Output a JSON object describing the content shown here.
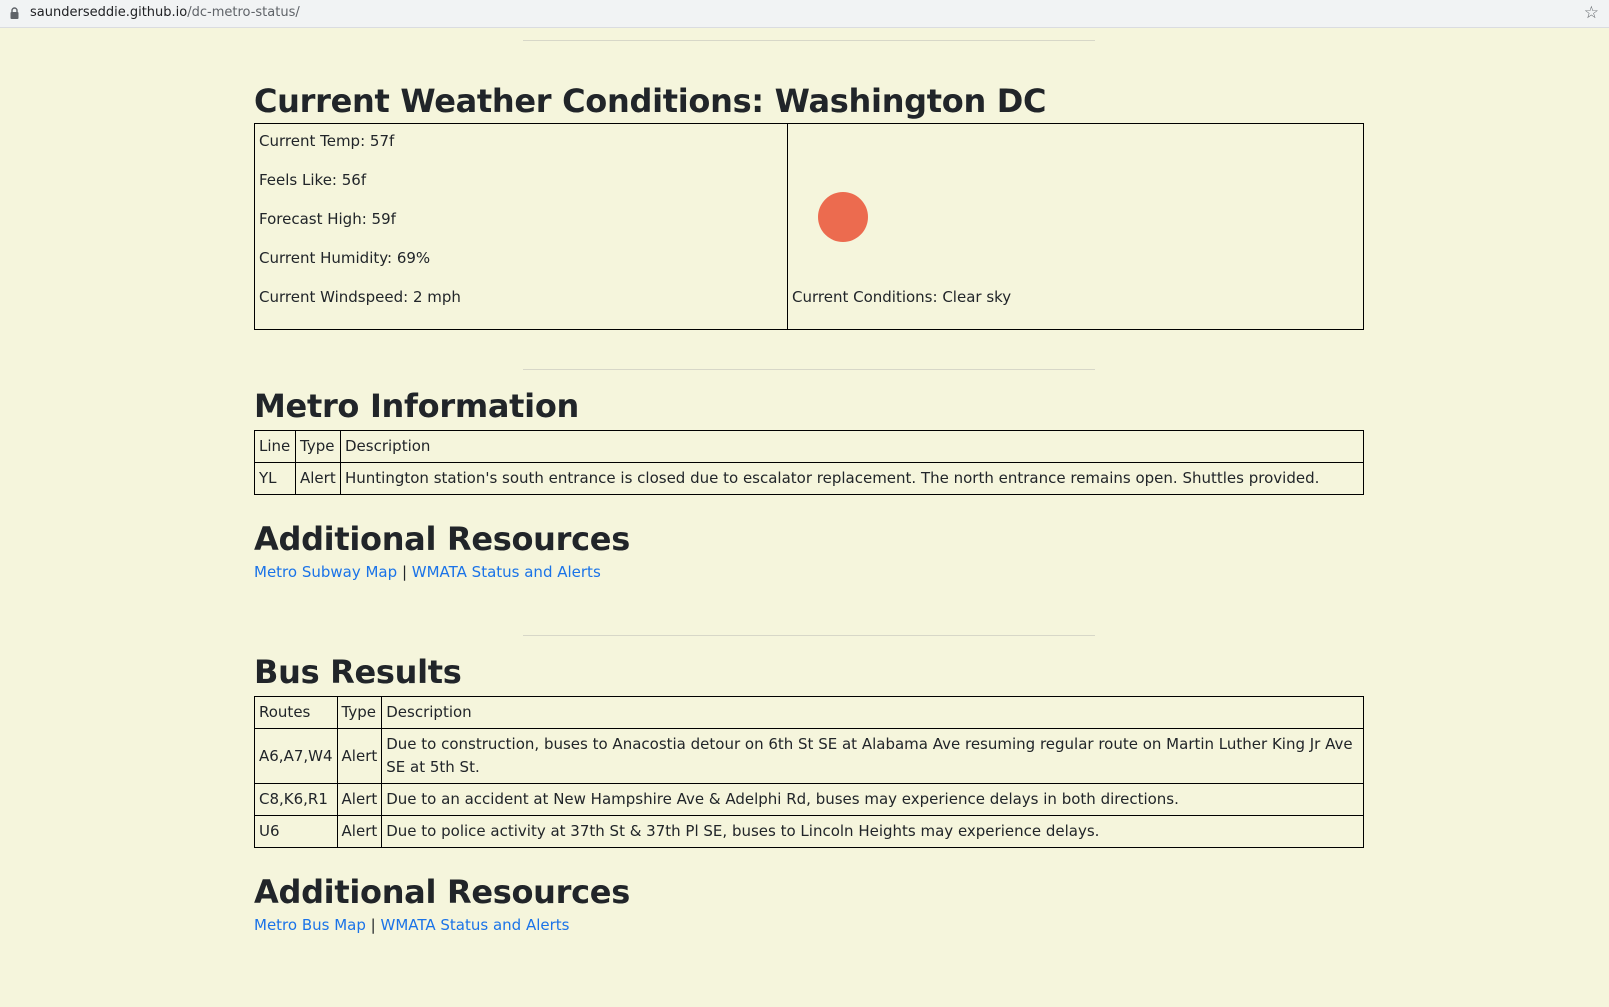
{
  "browser": {
    "url_host": "saunderseddie.github.io",
    "url_path": "/dc-metro-status/"
  },
  "weather": {
    "heading": "Current Weather Conditions: Washington DC",
    "temp": "Current Temp: 57f",
    "feels_like": "Feels Like: 56f",
    "forecast_high": "Forecast High: 59f",
    "humidity": "Current Humidity: 69%",
    "windspeed": "Current Windspeed: 2 mph",
    "icon": "sun-icon",
    "icon_color": "#ec6b4f",
    "conditions": "Current Conditions: Clear sky"
  },
  "metro": {
    "heading": "Metro Information",
    "headers": [
      "Line",
      "Type",
      "Description"
    ],
    "rows": [
      [
        "YL",
        "Alert",
        "Huntington station's south entrance is closed due to escalator replacement. The north entrance remains open. Shuttles provided."
      ]
    ],
    "resources_heading": "Additional Resources",
    "link1": "Metro Subway Map",
    "separator": "|",
    "link2": "WMATA Status and Alerts"
  },
  "bus": {
    "heading": "Bus Results",
    "headers": [
      "Routes",
      "Type",
      "Description"
    ],
    "rows": [
      [
        "A6,A7,W4",
        "Alert",
        "Due to construction, buses to Anacostia detour on 6th St SE at Alabama Ave resuming regular route on Martin Luther King Jr Ave SE at 5th St."
      ],
      [
        "C8,K6,R1",
        "Alert",
        "Due to an accident at New Hampshire Ave & Adelphi Rd, buses may experience delays in both directions."
      ],
      [
        "U6",
        "Alert",
        "Due to police activity at 37th St & 37th Pl SE, buses to Lincoln Heights may experience delays."
      ]
    ],
    "resources_heading": "Additional Resources",
    "link1": "Metro Bus Map",
    "separator": "|",
    "link2": "WMATA Status and Alerts"
  },
  "colors": {
    "background": "#f5f5dc",
    "link": "#1a73e8"
  }
}
